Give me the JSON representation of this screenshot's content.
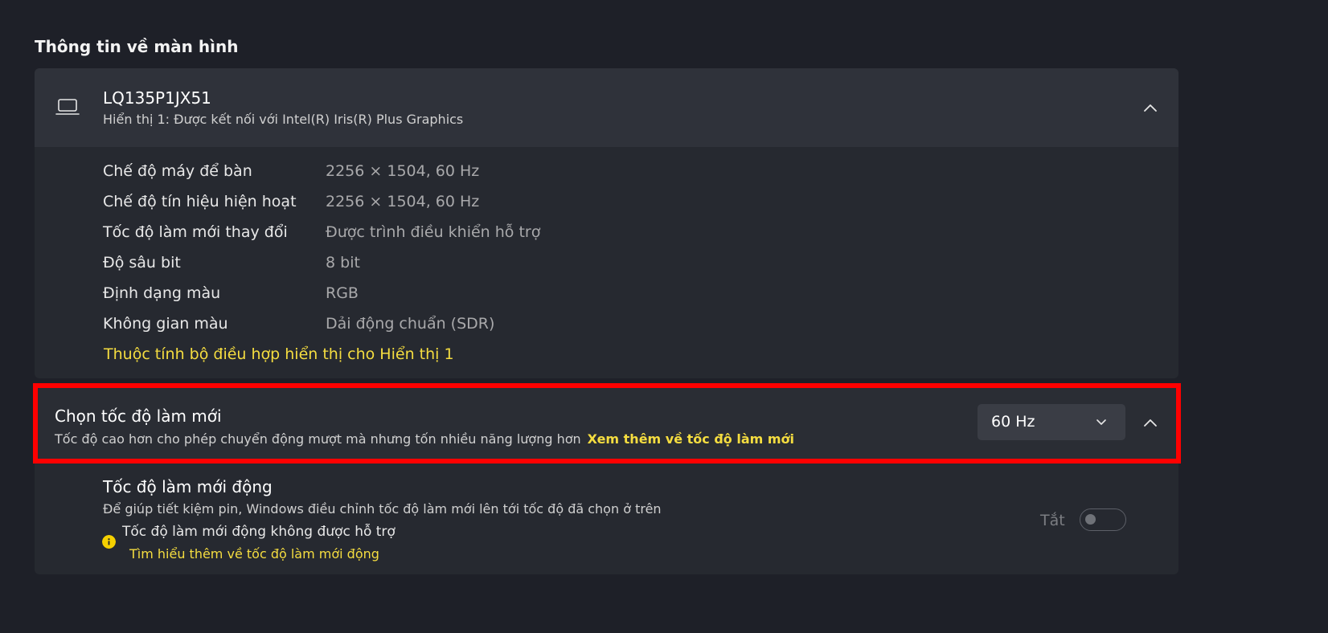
{
  "section": {
    "title": "Thông tin về màn hình"
  },
  "display": {
    "name": "LQ135P1JX51",
    "subtitle": "Hiển thị 1: Được kết nối với Intel(R) Iris(R) Plus Graphics",
    "icon": "laptop-icon",
    "collapse_icon": "chevron-up-icon",
    "details": [
      {
        "label": "Chế độ máy để bàn",
        "value": "2256 × 1504, 60 Hz"
      },
      {
        "label": "Chế độ tín hiệu hiện hoạt",
        "value": "2256 × 1504, 60 Hz"
      },
      {
        "label": "Tốc độ làm mới thay đổi",
        "value": "Được trình điều khiển hỗ trợ"
      },
      {
        "label": "Độ sâu bit",
        "value": "8 bit"
      },
      {
        "label": "Định dạng màu",
        "value": "RGB"
      },
      {
        "label": "Không gian màu",
        "value": "Dải động chuẩn (SDR)"
      }
    ],
    "adapter_link": "Thuộc tính bộ điều hợp hiển thị cho Hiển thị 1"
  },
  "refresh_rate": {
    "title": "Chọn tốc độ làm mới",
    "description": "Tốc độ cao hơn cho phép chuyển động mượt mà nhưng tốn nhiều năng lượng hơn",
    "link": "Xem thêm về tốc độ làm mới",
    "selected": "60 Hz",
    "dropdown_icon": "chevron-down-icon",
    "collapse_icon": "chevron-up-icon",
    "highlight_color": "#ff0000"
  },
  "dynamic_refresh": {
    "title": "Tốc độ làm mới động",
    "description": "Để giúp tiết kiệm pin, Windows điều chỉnh tốc độ làm mới lên tới tốc độ đã chọn ở trên",
    "warning": "Tốc độ làm mới động không được hỗ trợ",
    "warning_icon": "info-icon",
    "learn_more": "Tìm hiểu thêm về tốc độ làm mới động",
    "toggle_label": "Tắt",
    "toggle_on": false
  },
  "colors": {
    "accent_link": "#f5dd40",
    "background": "#1e2028",
    "card": "#2a2d34"
  }
}
